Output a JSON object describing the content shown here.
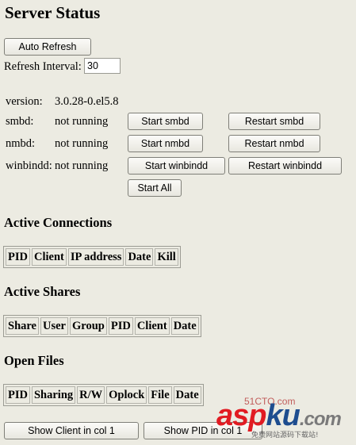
{
  "page": {
    "title": "Server Status"
  },
  "controls": {
    "auto_refresh_label": "Auto Refresh",
    "refresh_interval_label": "Refresh Interval:",
    "refresh_interval_value": "30"
  },
  "status": {
    "version_label": "version:",
    "version_value": "3.0.28-0.el5.8",
    "rows": [
      {
        "name": "smbd:",
        "state": "not running",
        "start_label": "Start smbd",
        "restart_label": "Restart smbd"
      },
      {
        "name": "nmbd:",
        "state": "not running",
        "start_label": "Start nmbd",
        "restart_label": "Restart nmbd"
      },
      {
        "name": "winbindd:",
        "state": "not running",
        "start_label": "Start winbindd",
        "restart_label": "Restart winbindd"
      }
    ],
    "start_all_label": "Start All"
  },
  "connections": {
    "heading": "Active Connections",
    "columns": [
      "PID",
      "Client",
      "IP address",
      "Date",
      "Kill"
    ]
  },
  "shares": {
    "heading": "Active Shares",
    "columns": [
      "Share",
      "User",
      "Group",
      "PID",
      "Client",
      "Date"
    ]
  },
  "files": {
    "heading": "Open Files",
    "columns": [
      "PID",
      "Sharing",
      "R/W",
      "Oplock",
      "File",
      "Date"
    ]
  },
  "footer": {
    "show_client_label": "Show Client in col 1",
    "show_pid_label": "Show PID in col 1"
  },
  "watermark": {
    "brand_a": "asp",
    "brand_b": "ku",
    "brand_c": ".com",
    "small": "51CTO.com",
    "sub": "免费网站源码下载站!"
  },
  "colors": {
    "background": "#ecebe2",
    "watermark_red": "#e11b22",
    "watermark_blue": "#1e4d8f"
  }
}
